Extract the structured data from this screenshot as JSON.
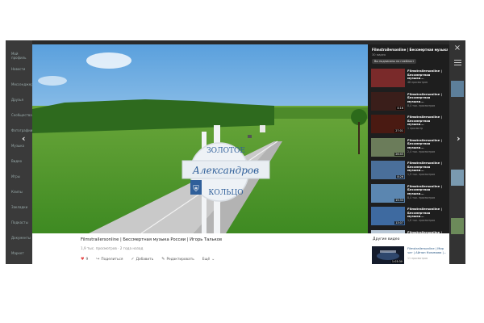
{
  "background_sidebar": [
    "Мой профиль",
    "Новости",
    "Мессенджер",
    "Друзья",
    "Сообщества",
    "Фотографии",
    "Музыка",
    "Видео",
    "Игры",
    "Клипы",
    "Закладки",
    "Подкасты",
    "Документы",
    "Маркет"
  ],
  "video": {
    "title": "Filmstrailersonline | Бессмертная музыка России | Игорь Тальков",
    "meta": "1,9 тыс. просмотров · 2 года назад",
    "sign_text": "Александров"
  },
  "actions": {
    "like_count": "9",
    "share_label": "Поделиться",
    "add_label": "Добавить",
    "edit_label": "Редактировать",
    "more_label": "Ещё"
  },
  "playlist": {
    "title": "Filmstrailersonline | Бессмертная музыка России",
    "count": "30 видео",
    "subscribe_label": "Вы подписаны на плейлист",
    "items": [
      {
        "title": "Filmstrailersonline | Бессмертная музыка...",
        "views": "48 просмотров",
        "duration": "",
        "color": "#7a2a2a"
      },
      {
        "title": "Filmstrailersonline | Бессмертная музыка...",
        "views": "8,4 тыс. просмотров",
        "duration": "4:16",
        "color": "#3a1e1a"
      },
      {
        "title": "Filmstrailersonline | Бессмертная музыка...",
        "views": "1 просмотр",
        "duration": "27:01",
        "color": "#4a1a12"
      },
      {
        "title": "Filmstrailersonline | Бессмертная музыка...",
        "views": "2,4 тыс. просмотров",
        "duration": "26:45",
        "color": "#6b7c5a"
      },
      {
        "title": "Filmstrailersonline | Бессмертная музыка...",
        "views": "1,9 тыс. просмотров",
        "duration": "8:26",
        "color": "#4a6f9a"
      },
      {
        "title": "Filmstrailersonline | Бессмертная музыка...",
        "views": "8,4 тыс. просмотров",
        "duration": "15:33",
        "color": "#5b86b0"
      },
      {
        "title": "Filmstrailersonline | Бессмертная музыка...",
        "views": "1,6 тыс. просмотров",
        "duration": "13:07",
        "color": "#3e6aa0"
      },
      {
        "title": "Filmstrailersonline | Бессмертная музыка...",
        "views": "",
        "duration": "",
        "color": "#b8c7d6"
      }
    ]
  },
  "other_videos": {
    "label": "Другие видео",
    "item": {
      "title": "Filmstrailersonline | Мир чат | Айгюн Кязимова |...",
      "views": "11 просмотров",
      "duration": "1:03:30"
    }
  },
  "icons": {
    "close": "close-icon",
    "playlist": "list-icon",
    "prev": "chevron-left-icon",
    "next": "chevron-right-icon"
  },
  "colors": {
    "like": "#e64646",
    "link": "#2a5885",
    "playlist_bg": "#1e1e1e"
  }
}
